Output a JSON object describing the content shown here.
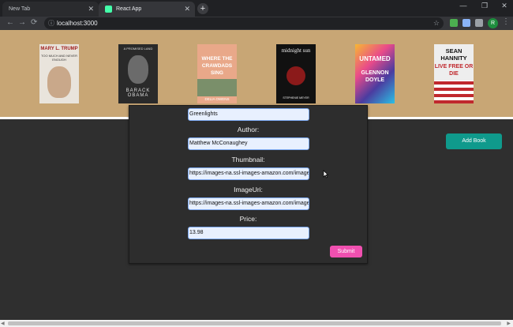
{
  "browser": {
    "tabs": [
      {
        "title": "New Tab",
        "active": false
      },
      {
        "title": "React App",
        "active": true
      }
    ],
    "url": "localhost:3000",
    "profile_initial": "R"
  },
  "books": [
    {
      "title": "MARY L. TRUMP",
      "subtitle": "TOO MUCH AND NEVER ENOUGH",
      "color": "#e9e4dc"
    },
    {
      "title": "A PROMISED LAND",
      "subtitle": "BARACK OBAMA",
      "color": "#2a2a2a"
    },
    {
      "title": "WHERE THE CRAWDADS SING",
      "subtitle": "DELIA OWENS",
      "color": "#e9a889"
    },
    {
      "title": "midnight sun",
      "subtitle": "STEPHENIE MEYER",
      "color": "#111111"
    },
    {
      "title": "UNTAMED",
      "subtitle": "GLENNON DOYLE",
      "color": "#d33fa0"
    },
    {
      "title": "SEAN HANNITY",
      "subtitle": "LIVE FREE OR DIE",
      "color": "#eeeeee"
    }
  ],
  "form": {
    "title_value": "Greenlights",
    "author_label": "Author:",
    "author_value": "Matthew McConaughey",
    "thumbnail_label": "Thumbnail:",
    "thumbnail_value": "https://images-na.ssl-images-amazon.com/images/I",
    "imageuri_label": "ImageUri:",
    "imageuri_value": "https://images-na.ssl-images-amazon.com/images/I",
    "price_label": "Price:",
    "price_value": "13.98",
    "submit_label": "Submit"
  },
  "add_book_label": "Add Book",
  "colors": {
    "shelf": "#c8a675",
    "page_bg": "#2f2f2f",
    "submit": "#f050b0",
    "add_book": "#0f9a8c"
  }
}
